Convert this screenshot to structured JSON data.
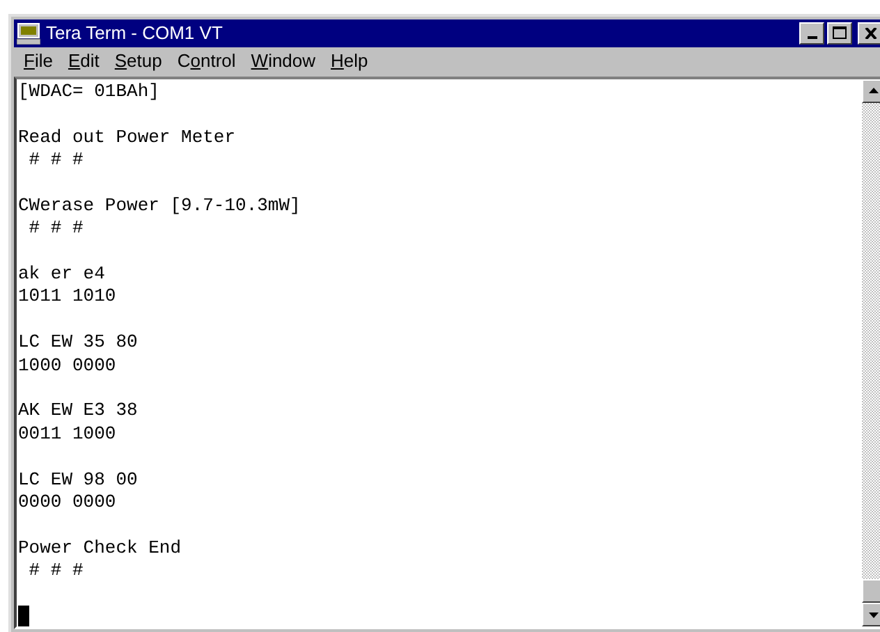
{
  "window": {
    "title": "Tera Term - COM1 VT"
  },
  "menu": [
    {
      "label": [
        {
          "text": "F",
          "underlined": true
        },
        {
          "text": "ile",
          "underlined": false
        }
      ]
    },
    {
      "label": [
        {
          "text": "E",
          "underlined": true
        },
        {
          "text": "dit",
          "underlined": false
        }
      ]
    },
    {
      "label": [
        {
          "text": "S",
          "underlined": true
        },
        {
          "text": "etup",
          "underlined": false
        }
      ]
    },
    {
      "label": [
        {
          "text": "C",
          "underlined": false
        },
        {
          "text": "o",
          "underlined": true
        },
        {
          "text": "ntrol",
          "underlined": false
        }
      ]
    },
    {
      "label": [
        {
          "text": "W",
          "underlined": true
        },
        {
          "text": "indow",
          "underlined": false
        }
      ]
    },
    {
      "label": [
        {
          "text": "H",
          "underlined": true
        },
        {
          "text": "elp",
          "underlined": false
        }
      ]
    }
  ],
  "terminal": {
    "blocks": [
      [
        "[WDAC= 01BAh]"
      ],
      [
        "Read out Power Meter",
        " # # #"
      ],
      [
        "CWerase Power [9.7-10.3mW]",
        " # # #"
      ],
      [
        "ak er e4",
        "1011 1010"
      ],
      [
        "LC EW 35 80",
        "1000 0000"
      ],
      [
        "AK EW E3 38",
        "0011 1000"
      ],
      [
        "LC EW 98 00",
        "0000 0000"
      ],
      [
        "Power Check End",
        " # # #"
      ]
    ]
  }
}
